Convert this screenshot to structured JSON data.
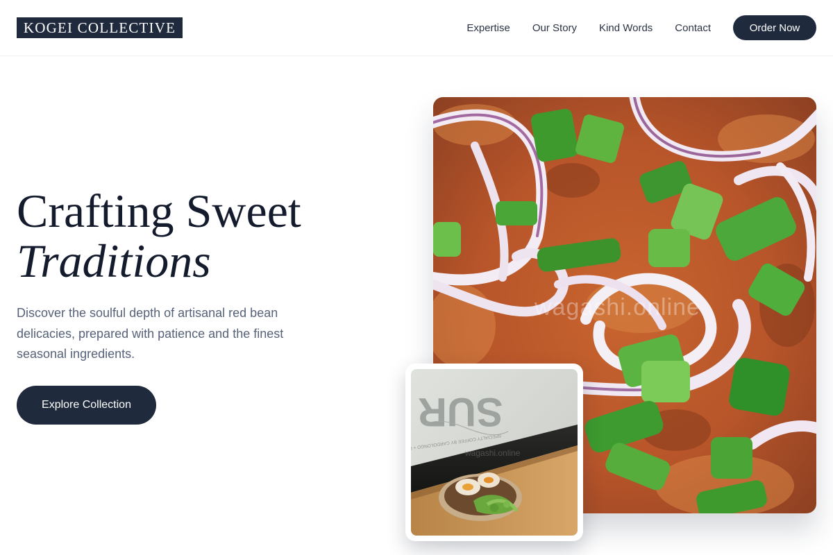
{
  "header": {
    "logo": "KOGEI COLLECTIVE",
    "nav": [
      "Expertise",
      "Our Story",
      "Kind Words",
      "Contact"
    ],
    "cta": "Order Now"
  },
  "hero": {
    "title_line1": "Crafting Sweet",
    "title_line2": "Traditions",
    "description": "Discover the soulful depth of artisanal red bean delicacies, prepared with patience and the finest seasonal ingredients.",
    "button": "Explore Collection"
  },
  "images": {
    "main_watermark": "wagashi.online",
    "small_watermark": "wagashi.online",
    "small_sign_text": "SPECIALTY COFFEE BY CARDOLONGO + CBD",
    "small_sign_letters": "SUR"
  },
  "colors": {
    "brand_dark": "#1f2a3d",
    "title": "#141b2d",
    "body_text": "#56627a"
  }
}
